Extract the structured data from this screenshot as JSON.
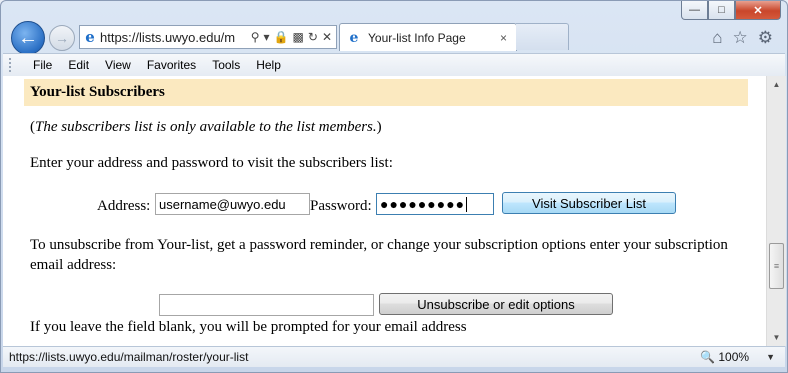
{
  "browser": {
    "address_url": "https://lists.uwyo.edu/m",
    "tab_title": "Your-list Info Page",
    "tab_close": "×",
    "caption": {
      "minimize": "—",
      "maximize": "□",
      "close": "✕"
    }
  },
  "menu": [
    "File",
    "Edit",
    "View",
    "Favorites",
    "Tools",
    "Help"
  ],
  "page": {
    "section_title": "Your-list Subscribers",
    "note_prefix": "(",
    "note_italic": "The subscribers list is only available to the list members.",
    "note_suffix": ")",
    "enter_text": "Enter your address and password to visit the subscribers list:",
    "address_label": "Address:",
    "address_value": "username@uwyo.edu",
    "password_label": "Password:",
    "password_mask": "●●●●●●●●●",
    "visit_button": "Visit Subscriber List",
    "unsub_text_1": "To unsubscribe from Your-list, get a password reminder, or change your subscription options enter your subscription",
    "unsub_text_2": "email address:",
    "unsub_button": "Unsubscribe or edit options",
    "blank_note": "If you leave the field blank, you will be prompted for your email address"
  },
  "status": {
    "url": "https://lists.uwyo.edu/mailman/roster/your-list",
    "zoom": "100%"
  }
}
